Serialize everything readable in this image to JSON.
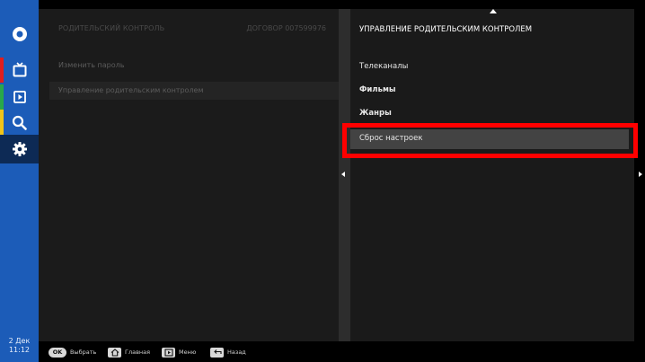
{
  "sidebar": {
    "items": [
      {
        "icon": "home-icon"
      },
      {
        "icon": "tv-icon",
        "strip_color": "#e01e1e"
      },
      {
        "icon": "video-icon",
        "strip_color": "#29a84a"
      },
      {
        "icon": "search-icon",
        "strip_color": "#f0c419"
      },
      {
        "icon": "gear-icon",
        "selected": true
      }
    ],
    "clock": {
      "date": "2 Дек",
      "time": "11:12"
    },
    "color": "#1c5cb8"
  },
  "left_panel": {
    "title": "РОДИТЕЛЬСКИЙ КОНТРОЛЬ",
    "contract": "ДОГОВОР 007599976",
    "items": [
      {
        "label": "Изменить пароль"
      },
      {
        "label": "Управление родительским контролем",
        "active": true
      }
    ]
  },
  "right_panel": {
    "title": "УПРАВЛЕНИЕ РОДИТЕЛЬСКИМ КОНТРОЛЕМ",
    "items": [
      {
        "label": "Телеканалы"
      },
      {
        "label": "Фильмы"
      },
      {
        "label": "Жанры"
      },
      {
        "label": "Сброс настроек",
        "selected": true
      }
    ]
  },
  "bottom_bar": {
    "hints": [
      {
        "key": "OK",
        "label": "Выбрать"
      },
      {
        "key": "home-icon",
        "label": "Главная"
      },
      {
        "key": "menu-icon",
        "label": "Меню"
      },
      {
        "key": "back-icon",
        "label": "Назад"
      }
    ]
  },
  "colors": {
    "highlight": "#ff0000",
    "selected_row": "#434343"
  }
}
